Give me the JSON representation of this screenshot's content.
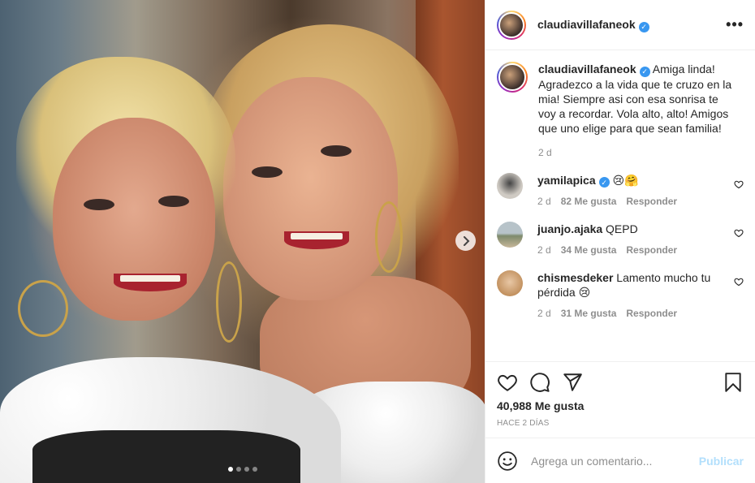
{
  "post": {
    "author": "claudiavillafaneok",
    "verified": true,
    "more_icon": "more-horizontal-icon"
  },
  "caption": {
    "username": "claudiavillafaneok",
    "text": "Amiga linda! Agradezco a la vida que te cruzo en la mia! Siempre asi con esa sonrisa te voy a recordar. Vola alto, alto! Amigos que uno elige para que sean familia!",
    "time": "2 d"
  },
  "comments": [
    {
      "username": "yamilapica",
      "verified": true,
      "text": "😢🤗",
      "time": "2 d",
      "likes": "82 Me gusta",
      "reply": "Responder",
      "avatar_color": "#d6d2cc"
    },
    {
      "username": "juanjo.ajaka",
      "verified": false,
      "text": "QEPD",
      "time": "2 d",
      "likes": "34 Me gusta",
      "reply": "Responder",
      "avatar_color": "#9aa7ad"
    },
    {
      "username": "chismesdeker",
      "verified": false,
      "text": "Lamento mucho tu pérdida 😢",
      "time": "2 d",
      "likes": "31 Me gusta",
      "reply": "Responder",
      "avatar_color": "#d9b48f"
    }
  ],
  "stats": {
    "likes": "40,988 Me gusta",
    "posted_ago": "HACE 2 DÍAS"
  },
  "composer": {
    "placeholder": "Agrega un comentario...",
    "publish_label": "Publicar"
  },
  "carousel": {
    "slide_count": 4,
    "current_slide": 1
  },
  "colors": {
    "verified": "#3897f0",
    "publish_disabled": "#b2dffc",
    "meta_text": "#8e8e8e"
  }
}
